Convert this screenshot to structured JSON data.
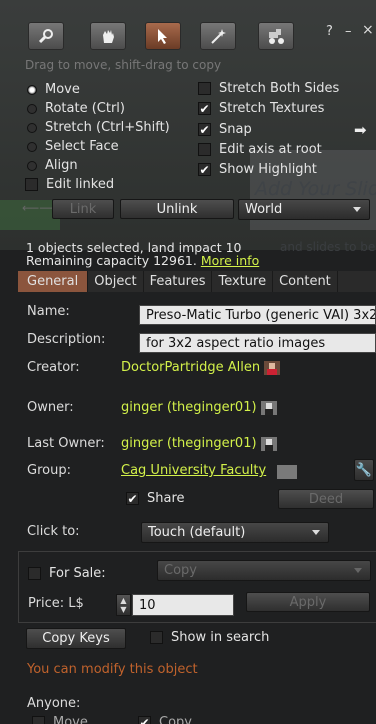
{
  "toolbar": {
    "tools": [
      "magnifier-tool-icon",
      "grab-hand-tool-icon",
      "select-arrow-tool-icon",
      "magic-wand-tool-icon",
      "land-tractor-tool-icon"
    ],
    "help": "?",
    "minimize": "–",
    "close": "×"
  },
  "hint": "Drag to move, shift-drag to copy",
  "modes": [
    {
      "label": "Move",
      "selected": true
    },
    {
      "label": "Rotate (Ctrl)",
      "selected": false
    },
    {
      "label": "Stretch (Ctrl+Shift)",
      "selected": false
    },
    {
      "label": "Select Face",
      "selected": false
    },
    {
      "label": "Align",
      "selected": false
    }
  ],
  "edit_linked": "Edit linked",
  "checks": [
    {
      "label": "Stretch Both Sides",
      "checked": false
    },
    {
      "label": "Stretch Textures",
      "checked": true
    },
    {
      "label": "Snap",
      "checked": true
    },
    {
      "label": "Edit axis at root",
      "checked": false
    },
    {
      "label": "Show Highlight",
      "checked": true
    }
  ],
  "link_btn": "Link",
  "unlink_btn": "Unlink",
  "coord_select": "World",
  "bg_text": {
    "a": "Add Your Slid",
    "b": "and slides to be"
  },
  "selection": {
    "line1": "1 objects selected, land impact 10",
    "line2": "Remaining capacity 12961.",
    "more_info": "More info"
  },
  "tabs": [
    "General",
    "Object",
    "Features",
    "Texture",
    "Content"
  ],
  "general": {
    "name_label": "Name:",
    "name_value": "Preso-Matic Turbo (generic VAI) 3x2",
    "desc_label": "Description:",
    "desc_value": "for 3x2 aspect ratio images",
    "creator_label": "Creator:",
    "creator_value": "DoctorPartridge Allen",
    "owner_label": "Owner:",
    "owner_value": "ginger (theginger01)",
    "last_owner_label": "Last Owner:",
    "last_owner_value": "ginger (theginger01)",
    "group_label": "Group:",
    "group_value": "Cag University Faculty",
    "share_label": "Share",
    "deed_btn": "Deed",
    "click_label": "Click to:",
    "click_value": "Touch  (default)",
    "for_sale_label": "For Sale:",
    "sale_type": "Copy",
    "price_label": "Price: L$",
    "price_value": "10",
    "apply_btn": "Apply",
    "copy_keys_btn": "Copy Keys",
    "show_search_label": "Show in search",
    "modify_notice": "You can modify this object",
    "anyone_label": "Anyone:",
    "anyone_move": "Move",
    "anyone_copy": "Copy"
  },
  "colors": {
    "accent_tab": "#8b553d",
    "link": "#d3f14a",
    "notice": "#c0622c"
  }
}
